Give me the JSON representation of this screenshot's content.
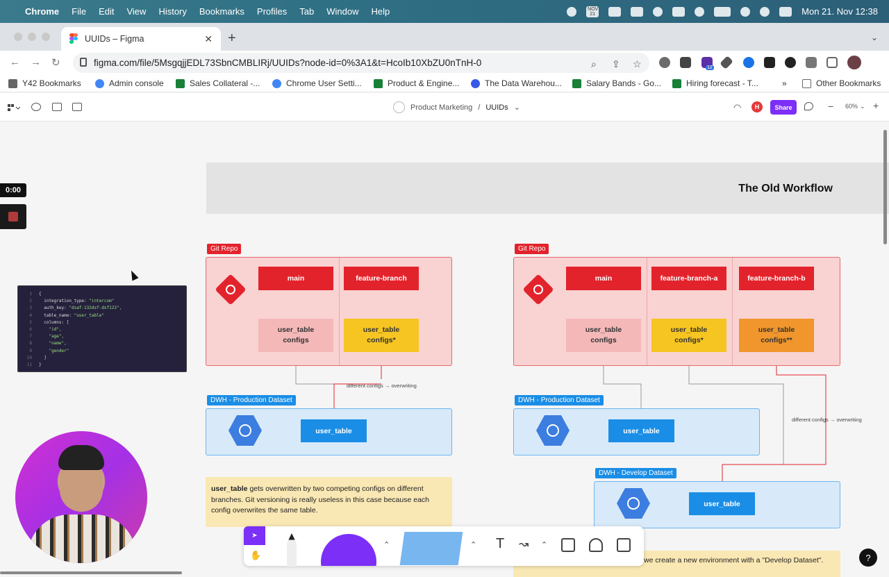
{
  "macos": {
    "app": "Chrome",
    "menus": [
      "File",
      "Edit",
      "View",
      "History",
      "Bookmarks",
      "Profiles",
      "Tab",
      "Window",
      "Help"
    ],
    "calendar_icon_label": "NOV 21",
    "clock": "Mon 21. Nov  12:38"
  },
  "browser": {
    "tab_title": "UUIDs – Figma",
    "url": "figma.com/file/5MsgqjjEDL73SbnCMBLIRj/UUIDs?node-id=0%3A1&t=HcoIb10XbZU0nTnH-0",
    "extension_badge": "12",
    "bookmarks": [
      "Y42 Bookmarks",
      "Admin console",
      "Sales Collateral -...",
      "Chrome User Setti...",
      "Product & Engine...",
      "The Data Warehou...",
      "Salary Bands - Go...",
      "Hiring forecast - T..."
    ],
    "other_bookmarks": "Other Bookmarks",
    "overflow": "»"
  },
  "figma": {
    "team": "Product Marketing",
    "separator": "/",
    "file": "UUIDs",
    "avatar_initial": "H",
    "share_label": "Share",
    "zoom": "60%"
  },
  "canvas": {
    "banner_title": "The Old Workflow",
    "left": {
      "repo_label": "Git Repo",
      "branches": [
        "main",
        "feature-branch"
      ],
      "configs": [
        "user_table\nconfigs",
        "user_table\nconfigs*"
      ],
      "dwh_label": "DWH - Production Dataset",
      "table": "user_table",
      "annotation": "different configs → overwriting",
      "note_bold": "user_table",
      "note_text": " gets overwritten by two competing configs on different branches. Git versioning is really useless in this case because each config overwrites the same table."
    },
    "right": {
      "repo_label": "Git Repo",
      "branches": [
        "main",
        "feature-branch-a",
        "feature-branch-b"
      ],
      "configs": [
        "user_table\nconfigs",
        "user_table\nconfigs*",
        "user_table\nconfigs**"
      ],
      "dwh_prod_label": "DWH - Production Dataset",
      "dwh_dev_label": "DWH - Develop Dataset",
      "table_prod": "user_table",
      "table_dev": "user_table",
      "annotation": "different configs → overwriting",
      "note_text": "we create a new environment with a \"Develop Dataset\"."
    },
    "code_lines": [
      [
        "1",
        "{"
      ],
      [
        "2",
        "  integration_type: ",
        "\"intercom\""
      ],
      [
        "3",
        "  auth_key: ",
        "\"dsaf-132dsf-dsf123\","
      ],
      [
        "4",
        "  table_name: ",
        "\"user_table\""
      ],
      [
        "5",
        "  columns: ["
      ],
      [
        "6",
        "    ",
        "\"id\","
      ],
      [
        "7",
        "    ",
        "\"age\","
      ],
      [
        "8",
        "    ",
        "\"name\","
      ],
      [
        "9",
        "    ",
        "\"gender\""
      ],
      [
        "10",
        "  ]"
      ],
      [
        "11",
        "}"
      ]
    ],
    "recorder_time": "0:00",
    "help": "?"
  },
  "colors": {
    "git_red": "#e3232c",
    "dwh_blue": "#1a8ee6",
    "figma_purple": "#7b2ff7",
    "note_yellow": "#fae8b4"
  }
}
